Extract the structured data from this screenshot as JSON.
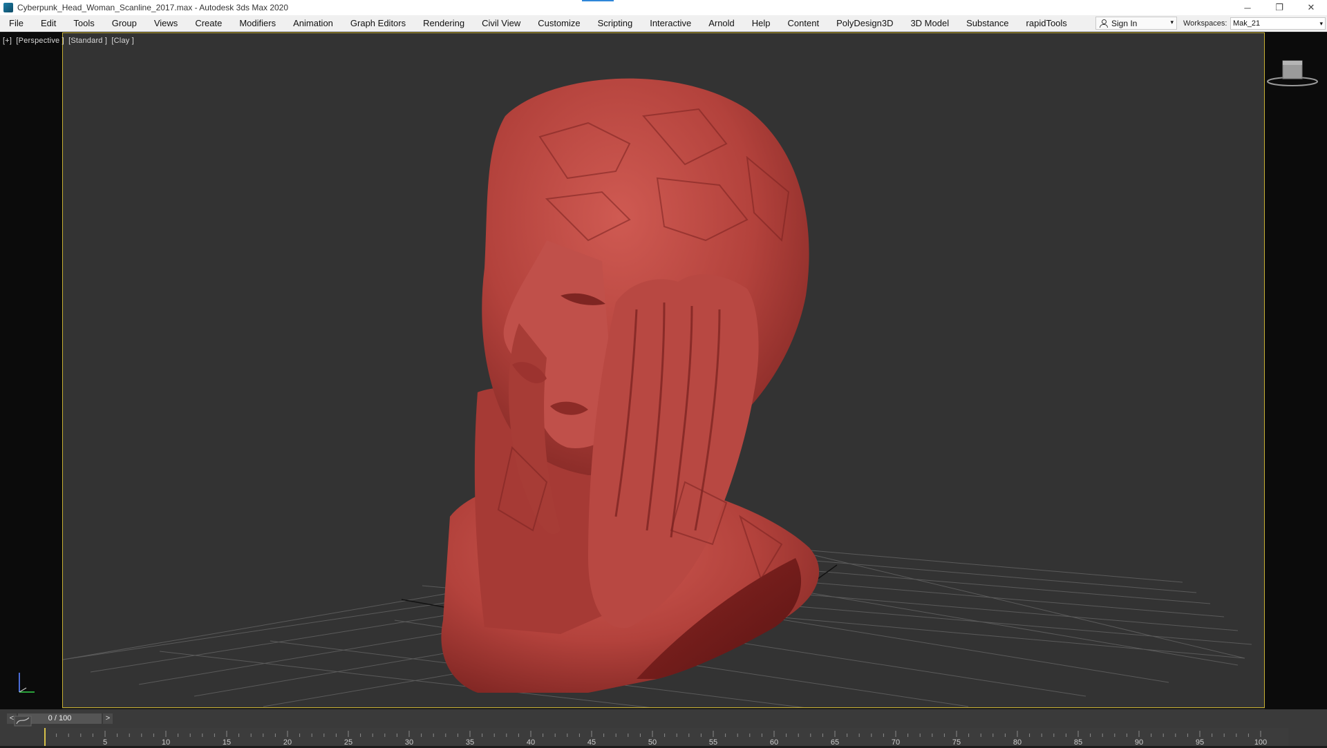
{
  "window": {
    "title": "Cyberpunk_Head_Woman_Scanline_2017.max - Autodesk 3ds Max 2020",
    "controls": [
      "─",
      "❐",
      "✕"
    ]
  },
  "menu": {
    "items": [
      "File",
      "Edit",
      "Tools",
      "Group",
      "Views",
      "Create",
      "Modifiers",
      "Animation",
      "Graph Editors",
      "Rendering",
      "Civil View",
      "Customize",
      "Scripting",
      "Interactive",
      "Arnold",
      "Help",
      "Content",
      "PolyDesign3D",
      "3D Model",
      "Substance",
      "rapidTools"
    ]
  },
  "account": {
    "sign_in_label": "Sign In",
    "dropdown_glyph": "▾"
  },
  "workspace": {
    "label": "Workspaces:",
    "value": "Mak_21",
    "dropdown_glyph": "▾"
  },
  "viewport": {
    "labels": [
      "[+]",
      "[Perspective ]",
      "[Standard ]",
      "[Clay ]"
    ],
    "model_color": "#b5443f",
    "background": "#333333",
    "border_color": "#c9b133"
  },
  "timeline": {
    "prev": "<",
    "next": ">",
    "frame_display": "0 / 100",
    "current_frame": 0,
    "ticks": [
      "5",
      "10",
      "15",
      "20",
      "25",
      "30",
      "35",
      "40",
      "45",
      "50",
      "55",
      "60",
      "65",
      "70",
      "75",
      "80",
      "85",
      "90",
      "95",
      "100"
    ]
  },
  "icons": {
    "app": "3ds-max-icon",
    "viewcube": "viewcube-icon",
    "axis": "axis-tripod-icon"
  }
}
